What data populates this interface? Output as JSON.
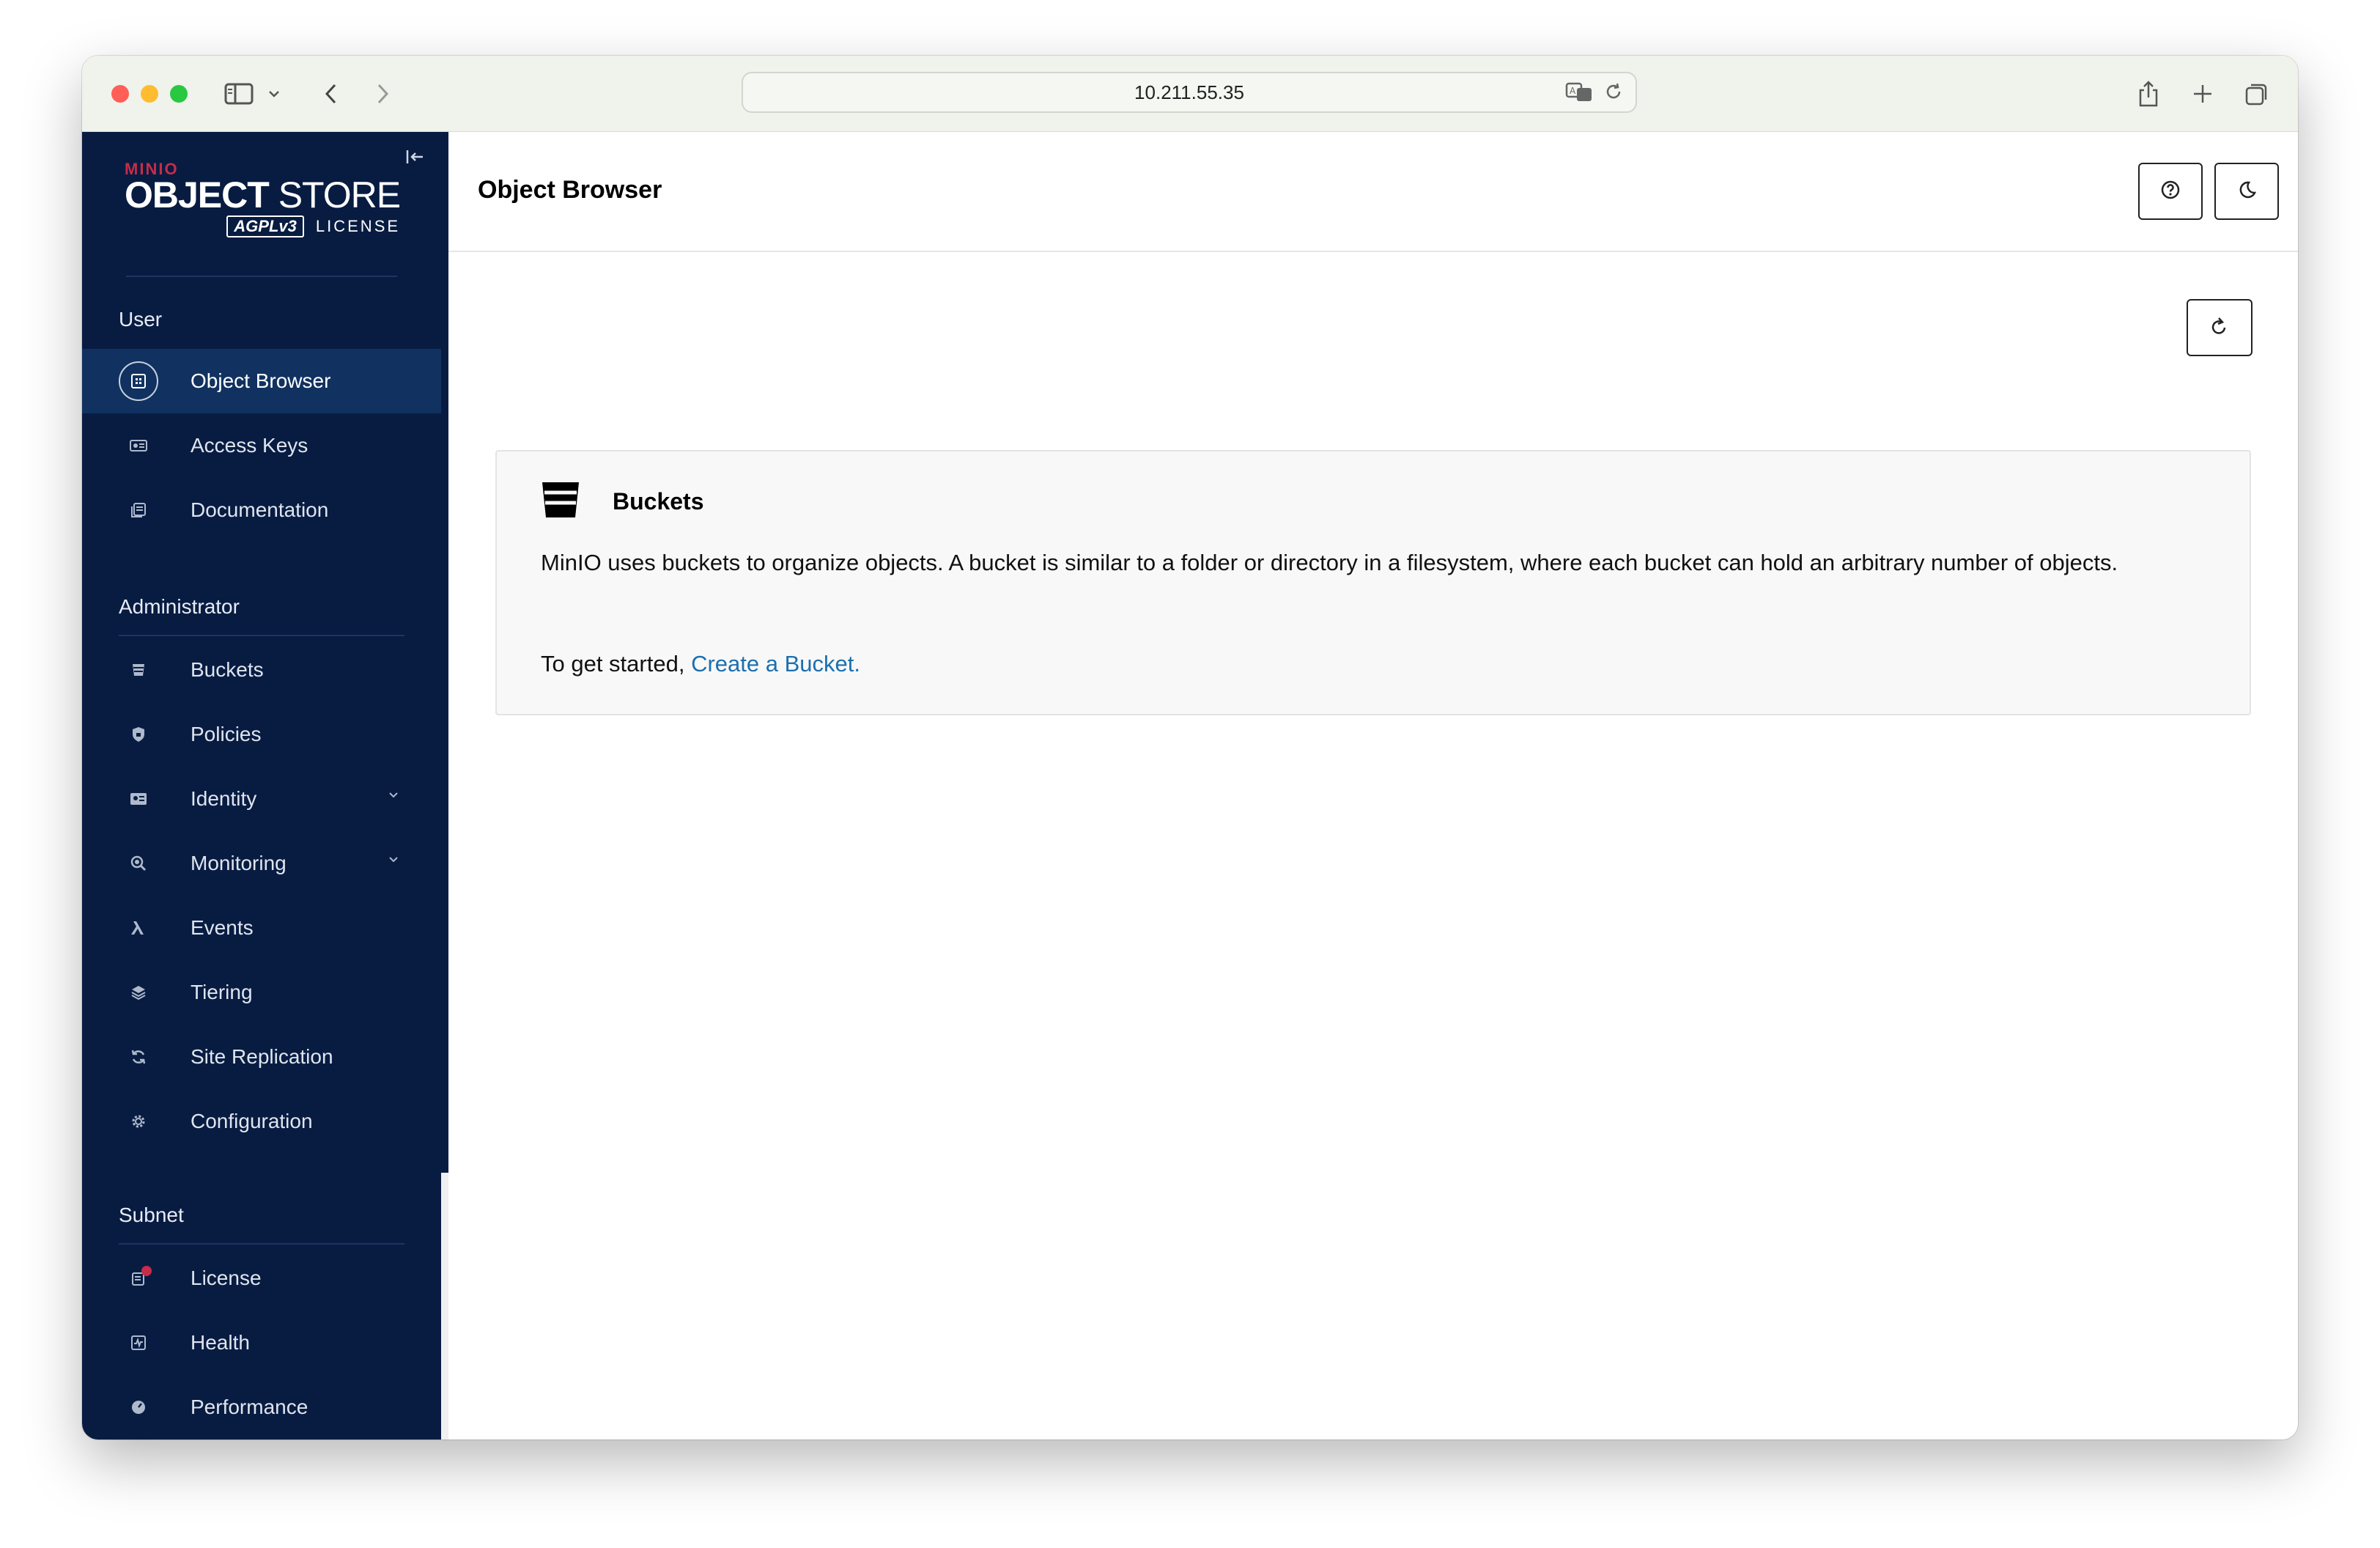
{
  "browser": {
    "address": "10.211.55.35",
    "traffic_lights": {
      "close": "#ff5f57",
      "minimize": "#febc2e",
      "zoom": "#28c840"
    }
  },
  "sidebar": {
    "logo": {
      "brand": "MINIO",
      "product_bold": "OBJECT",
      "product_light": " STORE",
      "license_badge": "AGPLv3",
      "license_label": "LICENSE"
    },
    "sections": {
      "user": "User",
      "administrator": "Administrator",
      "subnet": "Subnet"
    },
    "user_items": [
      {
        "label": "Object Browser",
        "icon": "object-browser-icon"
      },
      {
        "label": "Access Keys",
        "icon": "access-keys-icon"
      },
      {
        "label": "Documentation",
        "icon": "documentation-icon"
      }
    ],
    "admin_items": [
      {
        "label": "Buckets",
        "icon": "buckets-icon"
      },
      {
        "label": "Policies",
        "icon": "policies-icon"
      },
      {
        "label": "Identity",
        "icon": "identity-icon"
      },
      {
        "label": "Monitoring",
        "icon": "monitoring-icon"
      },
      {
        "label": "Events",
        "icon": "lambda-icon"
      },
      {
        "label": "Tiering",
        "icon": "tiering-icon"
      },
      {
        "label": "Site Replication",
        "icon": "site-replication-icon"
      },
      {
        "label": "Configuration",
        "icon": "gear-icon"
      }
    ],
    "subnet_items": [
      {
        "label": "License",
        "icon": "license-icon"
      },
      {
        "label": "Health",
        "icon": "health-icon"
      },
      {
        "label": "Performance",
        "icon": "performance-icon"
      }
    ],
    "colors": {
      "background": "#081c42",
      "active": "#113260",
      "notification_dot": "#c72c48"
    }
  },
  "main": {
    "title": "Object Browser",
    "buckets_box": {
      "title": "Buckets",
      "description": "MinIO uses buckets to organize objects. A bucket is similar to a folder or directory in a filesystem, where each bucket can hold an arbitrary number of objects.",
      "start_prefix": "To get started, ",
      "start_link": "Create a Bucket."
    },
    "colors": {
      "link": "#1b6fb0"
    }
  }
}
